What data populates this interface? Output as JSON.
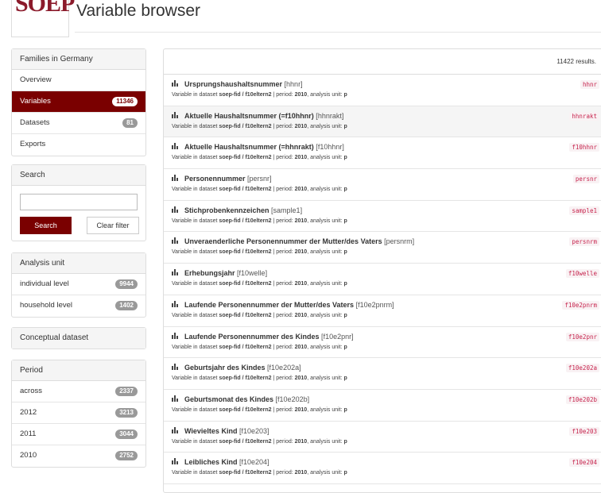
{
  "header": {
    "logo": "SOEP",
    "title": "Variable browser"
  },
  "sidebar": {
    "study": {
      "heading": "Families in Germany",
      "items": [
        {
          "label": "Overview",
          "count": null,
          "active": false
        },
        {
          "label": "Variables",
          "count": "11346",
          "active": true
        },
        {
          "label": "Datasets",
          "count": "81",
          "active": false
        },
        {
          "label": "Exports",
          "count": null,
          "active": false
        }
      ]
    },
    "search": {
      "heading": "Search",
      "input_value": "",
      "search_button": "Search",
      "clear_button": "Clear filter"
    },
    "analysis_unit": {
      "heading": "Analysis unit",
      "items": [
        {
          "label": "individual level",
          "count": "9944"
        },
        {
          "label": "household level",
          "count": "1402"
        }
      ]
    },
    "conceptual": {
      "heading": "Conceptual dataset"
    },
    "period": {
      "heading": "Period",
      "items": [
        {
          "label": "across",
          "count": "2337"
        },
        {
          "label": "2012",
          "count": "3213"
        },
        {
          "label": "2011",
          "count": "3044"
        },
        {
          "label": "2010",
          "count": "2752"
        }
      ]
    }
  },
  "results": {
    "count_text": "11422 results.",
    "meta_prefix": "Variable in dataset ",
    "items": [
      {
        "label": "Ursprungshaushaltsnummer",
        "name": "hhnr",
        "dataset": "soep-fid / f10eltern2",
        "period": "2010",
        "unit": "p"
      },
      {
        "label": "Aktuelle Haushaltsnummer (=f10hhnr)",
        "name": "hhnrakt",
        "dataset": "soep-fid / f10eltern2",
        "period": "2010",
        "unit": "p"
      },
      {
        "label": "Aktuelle Haushaltsnummer (=hhnrakt)",
        "name": "f10hhnr",
        "dataset": "soep-fid / f10eltern2",
        "period": "2010",
        "unit": "p"
      },
      {
        "label": "Personennummer",
        "name": "persnr",
        "dataset": "soep-fid / f10eltern2",
        "period": "2010",
        "unit": "p"
      },
      {
        "label": "Stichprobenkennzeichen",
        "name": "sample1",
        "dataset": "soep-fid / f10eltern2",
        "period": "2010",
        "unit": "p"
      },
      {
        "label": "Unveraenderliche Personennummer der Mutter/des Vaters",
        "name": "persnrm",
        "dataset": "soep-fid / f10eltern2",
        "period": "2010",
        "unit": "p"
      },
      {
        "label": "Erhebungsjahr",
        "name": "f10welle",
        "dataset": "soep-fid / f10eltern2",
        "period": "2010",
        "unit": "p"
      },
      {
        "label": "Laufende Personennummer der Mutter/des Vaters",
        "name": "f10e2pnrm",
        "dataset": "soep-fid / f10eltern2",
        "period": "2010",
        "unit": "p"
      },
      {
        "label": "Laufende Personennummer des Kindes",
        "name": "f10e2pnr",
        "dataset": "soep-fid / f10eltern2",
        "period": "2010",
        "unit": "p"
      },
      {
        "label": "Geburtsjahr des Kindes",
        "name": "f10e202a",
        "dataset": "soep-fid / f10eltern2",
        "period": "2010",
        "unit": "p"
      },
      {
        "label": "Geburtsmonat des Kindes",
        "name": "f10e202b",
        "dataset": "soep-fid / f10eltern2",
        "period": "2010",
        "unit": "p"
      },
      {
        "label": "Wievieltes Kind",
        "name": "f10e203",
        "dataset": "soep-fid / f10eltern2",
        "period": "2010",
        "unit": "p"
      },
      {
        "label": "Leibliches Kind",
        "name": "f10e204",
        "dataset": "soep-fid / f10eltern2",
        "period": "2010",
        "unit": "p"
      }
    ]
  }
}
